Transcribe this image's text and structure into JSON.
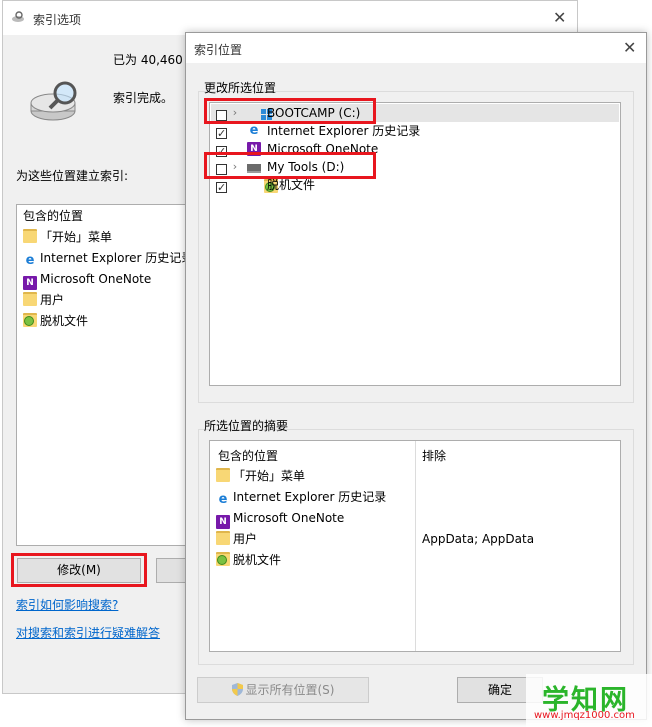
{
  "back": {
    "title": "索引选项",
    "count_text": "已为 40,460",
    "status_text": "索引完成。",
    "index_label": "为这些位置建立索引:",
    "list_header": "包含的位置",
    "items": [
      {
        "label": "「开始」菜单",
        "icon": "folder-icon"
      },
      {
        "label": "Internet Explorer 历史记录",
        "icon": "ie-icon"
      },
      {
        "label": "Microsoft OneNote",
        "icon": "onenote-icon"
      },
      {
        "label": "用户",
        "icon": "folder-icon"
      },
      {
        "label": "脱机文件",
        "icon": "offline-files-icon"
      }
    ],
    "modify_button": "修改(M)",
    "link_affect": "索引如何影响搜索?",
    "link_troubleshoot": "对搜索和索引进行疑难解答"
  },
  "front": {
    "title": "索引位置",
    "change_label": "更改所选位置",
    "tree": [
      {
        "label": "BOOTCAMP (C:)",
        "checked": false,
        "expandable": true,
        "icon": "windows-drive-icon"
      },
      {
        "label": "Internet Explorer 历史记录",
        "checked": true,
        "expandable": false,
        "icon": "ie-icon"
      },
      {
        "label": "Microsoft OneNote",
        "checked": true,
        "expandable": false,
        "icon": "onenote-icon"
      },
      {
        "label": "My Tools (D:)",
        "checked": false,
        "expandable": true,
        "icon": "drive-icon"
      },
      {
        "label": "脱机文件",
        "checked": true,
        "expandable": false,
        "icon": "offline-files-icon"
      }
    ],
    "summary_label": "所选位置的摘要",
    "summary_headers": {
      "included": "包含的位置",
      "excluded": "排除"
    },
    "summary_rows": [
      {
        "included": "「开始」菜单",
        "excluded": "",
        "icon": "folder-icon"
      },
      {
        "included": "Internet Explorer 历史记录",
        "excluded": "",
        "icon": "ie-icon"
      },
      {
        "included": "Microsoft OneNote",
        "excluded": "",
        "icon": "onenote-icon"
      },
      {
        "included": "用户",
        "excluded": "AppData; AppData",
        "icon": "folder-icon"
      },
      {
        "included": "脱机文件",
        "excluded": "",
        "icon": "offline-files-icon"
      }
    ],
    "show_all_button": "显示所有位置(S)",
    "ok_button": "确定"
  },
  "watermark": {
    "text": "学知网",
    "url": "www.jmqz1000.com"
  },
  "colors": {
    "highlight": "#e8161e",
    "link": "#0066cc",
    "window_bg": "#f0f0f0"
  }
}
